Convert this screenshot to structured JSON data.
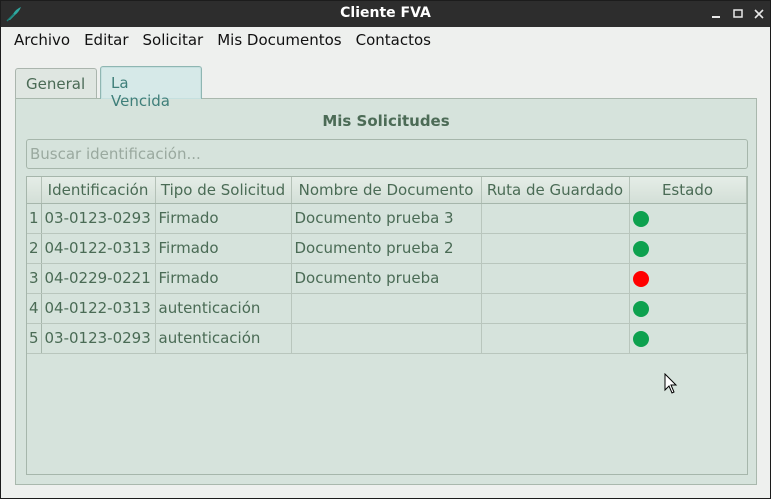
{
  "window": {
    "title": "Cliente FVA"
  },
  "menu": [
    "Archivo",
    "Editar",
    "Solicitar",
    "Mis Documentos",
    "Contactos"
  ],
  "tabs": [
    {
      "label": "General",
      "active": false
    },
    {
      "label": "La Vencida",
      "active": true
    }
  ],
  "panel": {
    "title": "Mis Solicitudes",
    "search_placeholder": "Buscar identificación..."
  },
  "table": {
    "columns": [
      "Identificación",
      "Tipo de Solicitud",
      "Nombre de Documento",
      "Ruta de Guardado",
      "Estado"
    ],
    "rows": [
      {
        "num": "1",
        "id": "03-0123-0293",
        "tipo": "Firmado",
        "nombre": "Documento prueba 3",
        "ruta": "",
        "estado": "green"
      },
      {
        "num": "2",
        "id": "04-0122-0313",
        "tipo": "Firmado",
        "nombre": "Documento prueba 2",
        "ruta": "",
        "estado": "green"
      },
      {
        "num": "3",
        "id": "04-0229-0221",
        "tipo": "Firmado",
        "nombre": "Documento prueba",
        "ruta": "",
        "estado": "red"
      },
      {
        "num": "4",
        "id": "04-0122-0313",
        "tipo": "autenticación",
        "nombre": "",
        "ruta": "",
        "estado": "green"
      },
      {
        "num": "5",
        "id": "03-0123-0293",
        "tipo": "autenticación",
        "nombre": "",
        "ruta": "",
        "estado": "green"
      }
    ]
  },
  "colors": {
    "green": "#0ea14f",
    "red": "#ff0000",
    "accent": "#4c6b56"
  },
  "icons": [
    "app-feather-icon",
    "minimize-icon",
    "maximize-icon",
    "close-icon",
    "mouse-cursor-icon"
  ]
}
